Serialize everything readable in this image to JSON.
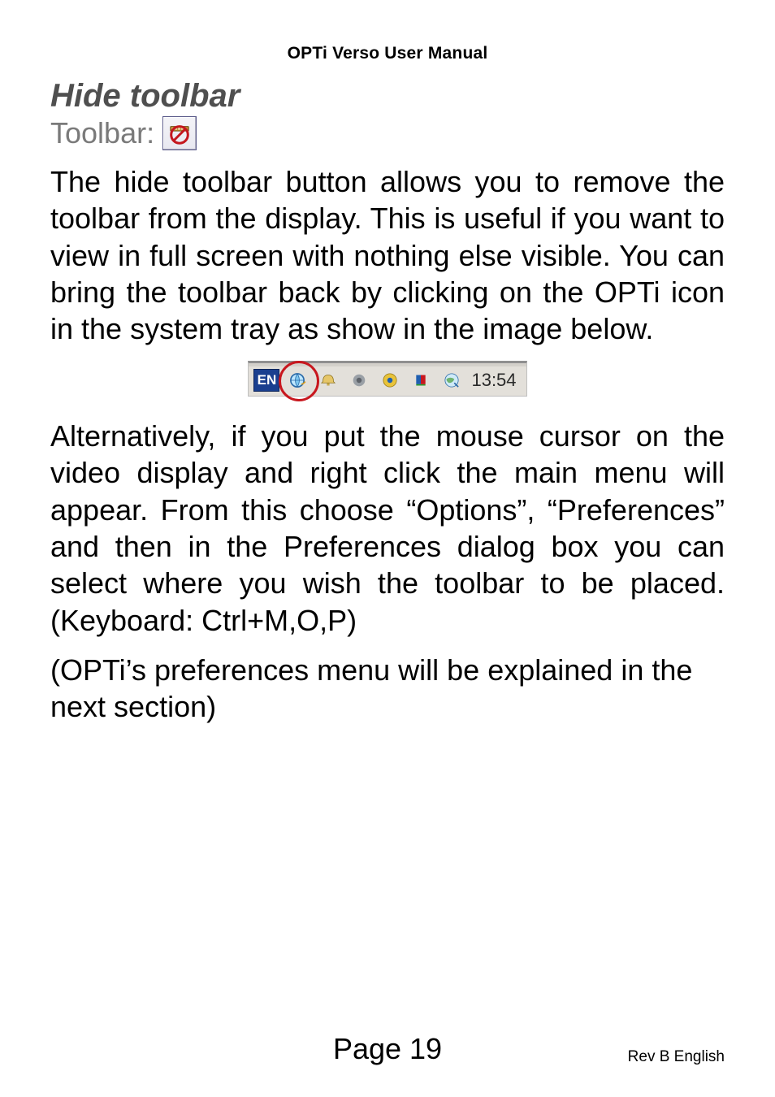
{
  "header": {
    "title": "OPTi Verso User Manual"
  },
  "section": {
    "heading": "Hide toolbar",
    "toolbar_label": "Toolbar:",
    "toolbar_icon_name": "hide-toolbar-icon"
  },
  "para1": "The hide toolbar button allows you to remove the toolbar from the display. This is useful if you want to view in full screen with nothing else visible. You can bring the toolbar back by clicking on the OPTi icon in the system tray as show in the image below.",
  "tray": {
    "lang_badge": "EN",
    "highlighted_icon": "opti-tray-icon",
    "icons": [
      "speaker-icon",
      "record-dot-icon",
      "dot-target-icon",
      "flag-icon",
      "globe-clock-icon"
    ],
    "time": "13:54"
  },
  "para2": "Alternatively, if you put the mouse cursor on the video display and right click the main menu will appear. From this choose “Options”, “Preferences” and then in the Preferences dialog box you can select where you wish the toolbar to be placed. (Keyboard: Ctrl+M,O,P)",
  "para3": "(OPTi’s preferences menu will be explained in the next section)",
  "footer": {
    "page_label": "Page 19",
    "revision": "Rev B English"
  }
}
